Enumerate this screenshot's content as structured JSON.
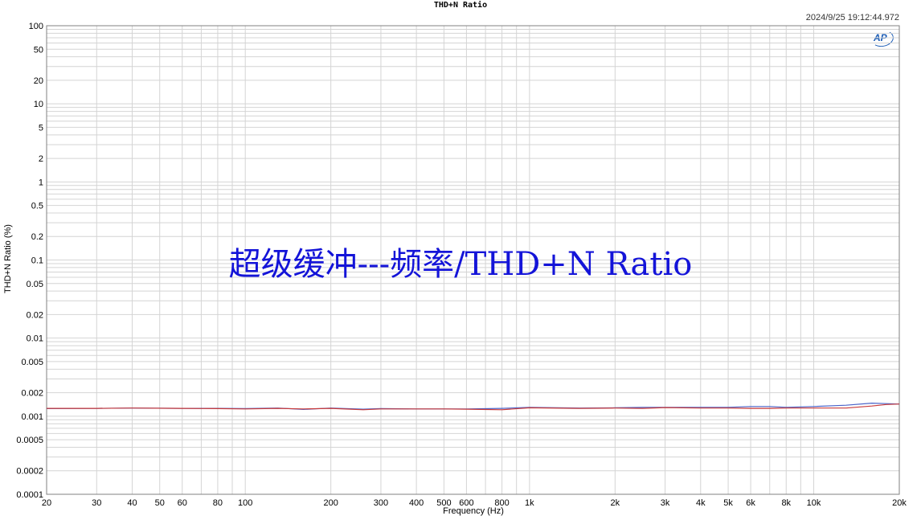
{
  "header": {
    "title": "THD+N Ratio",
    "timestamp": "2024/9/25 19:12:44.972",
    "logo_text": "AP"
  },
  "overlay_title": "超级缓冲---频率/THD+N Ratio",
  "colors": {
    "grid": "#d4d4d4",
    "axes": "#808080",
    "series_blue": "#4a63c8",
    "series_red": "#c83a3a",
    "overlay": "#1414d8"
  },
  "chart_data": {
    "type": "line",
    "title": "THD+N Ratio",
    "xlabel": "Frequency (Hz)",
    "ylabel": "THD+N Ratio (%)",
    "xscale": "log",
    "yscale": "log",
    "xlim": [
      20,
      20000
    ],
    "ylim": [
      0.0001,
      100
    ],
    "grid": true,
    "x_ticks": [
      {
        "value": 20,
        "label": "20"
      },
      {
        "value": 30,
        "label": "30"
      },
      {
        "value": 40,
        "label": "40"
      },
      {
        "value": 50,
        "label": "50"
      },
      {
        "value": 60,
        "label": "60"
      },
      {
        "value": 80,
        "label": "80"
      },
      {
        "value": 100,
        "label": "100"
      },
      {
        "value": 200,
        "label": "200"
      },
      {
        "value": 300,
        "label": "300"
      },
      {
        "value": 400,
        "label": "400"
      },
      {
        "value": 500,
        "label": "500"
      },
      {
        "value": 600,
        "label": "600"
      },
      {
        "value": 800,
        "label": "800"
      },
      {
        "value": 1000,
        "label": "1k"
      },
      {
        "value": 2000,
        "label": "2k"
      },
      {
        "value": 3000,
        "label": "3k"
      },
      {
        "value": 4000,
        "label": "4k"
      },
      {
        "value": 5000,
        "label": "5k"
      },
      {
        "value": 6000,
        "label": "6k"
      },
      {
        "value": 8000,
        "label": "8k"
      },
      {
        "value": 10000,
        "label": "10k"
      },
      {
        "value": 20000,
        "label": "20k"
      }
    ],
    "y_ticks": [
      {
        "value": 100,
        "label": "100"
      },
      {
        "value": 50,
        "label": "50"
      },
      {
        "value": 20,
        "label": "20"
      },
      {
        "value": 10,
        "label": "10"
      },
      {
        "value": 5,
        "label": "5"
      },
      {
        "value": 2,
        "label": "2"
      },
      {
        "value": 1,
        "label": "1"
      },
      {
        "value": 0.5,
        "label": "0.5"
      },
      {
        "value": 0.2,
        "label": "0.2"
      },
      {
        "value": 0.1,
        "label": "0.1"
      },
      {
        "value": 0.05,
        "label": "0.05"
      },
      {
        "value": 0.02,
        "label": "0.02"
      },
      {
        "value": 0.01,
        "label": "0.01"
      },
      {
        "value": 0.005,
        "label": "0.005"
      },
      {
        "value": 0.002,
        "label": "0.002"
      },
      {
        "value": 0.001,
        "label": "0.001"
      },
      {
        "value": 0.0005,
        "label": "0.0005"
      },
      {
        "value": 0.0002,
        "label": "0.0002"
      },
      {
        "value": 0.0001,
        "label": "0.0001"
      }
    ],
    "series": [
      {
        "color": "#4a63c8",
        "x": [
          20,
          30,
          40,
          60,
          80,
          100,
          130,
          160,
          200,
          260,
          300,
          400,
          500,
          600,
          800,
          1000,
          1500,
          2000,
          2500,
          3000,
          4000,
          5000,
          6000,
          7000,
          8000,
          10000,
          13000,
          16000,
          18000,
          20000
        ],
        "y": [
          0.00125,
          0.00126,
          0.00127,
          0.00126,
          0.00126,
          0.00125,
          0.00127,
          0.00122,
          0.00127,
          0.00123,
          0.00125,
          0.00124,
          0.00124,
          0.00124,
          0.00126,
          0.0013,
          0.00127,
          0.00128,
          0.0013,
          0.0013,
          0.0013,
          0.0013,
          0.00133,
          0.00133,
          0.0013,
          0.00133,
          0.00138,
          0.00147,
          0.00145,
          0.00143
        ]
      },
      {
        "color": "#c83a3a",
        "x": [
          20,
          30,
          40,
          60,
          80,
          100,
          130,
          160,
          200,
          260,
          300,
          400,
          500,
          600,
          800,
          1000,
          1500,
          2000,
          2500,
          3000,
          4000,
          5000,
          6000,
          7000,
          8000,
          10000,
          13000,
          16000,
          18000,
          20000
        ],
        "y": [
          0.00126,
          0.00126,
          0.00127,
          0.00126,
          0.00125,
          0.00124,
          0.00126,
          0.00124,
          0.00126,
          0.00121,
          0.00124,
          0.00124,
          0.00124,
          0.00123,
          0.00121,
          0.00128,
          0.00126,
          0.00127,
          0.00126,
          0.00129,
          0.00127,
          0.00127,
          0.00126,
          0.00126,
          0.00127,
          0.00127,
          0.00127,
          0.00135,
          0.00141,
          0.00143
        ]
      }
    ]
  }
}
